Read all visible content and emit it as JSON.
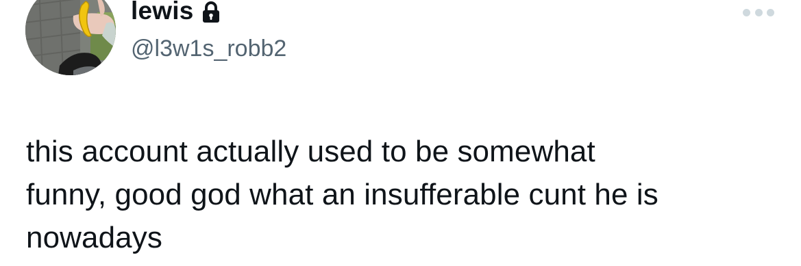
{
  "author": {
    "display_name": "lewis",
    "handle": "@l3w1s_robb2",
    "protected_icon": "lock-icon",
    "avatar_description_icon": "avatar-photo"
  },
  "menu": {
    "icon": "more-horizontal-icon"
  },
  "tweet": {
    "lines": [
      "this account actually used to be somewhat",
      "funny, good god what an insufferable cunt he is",
      "nowadays"
    ]
  },
  "colors": {
    "text_primary": "#0f1419",
    "text_secondary": "#536471",
    "menu_dots": "#cfd9de",
    "background": "#ffffff"
  }
}
